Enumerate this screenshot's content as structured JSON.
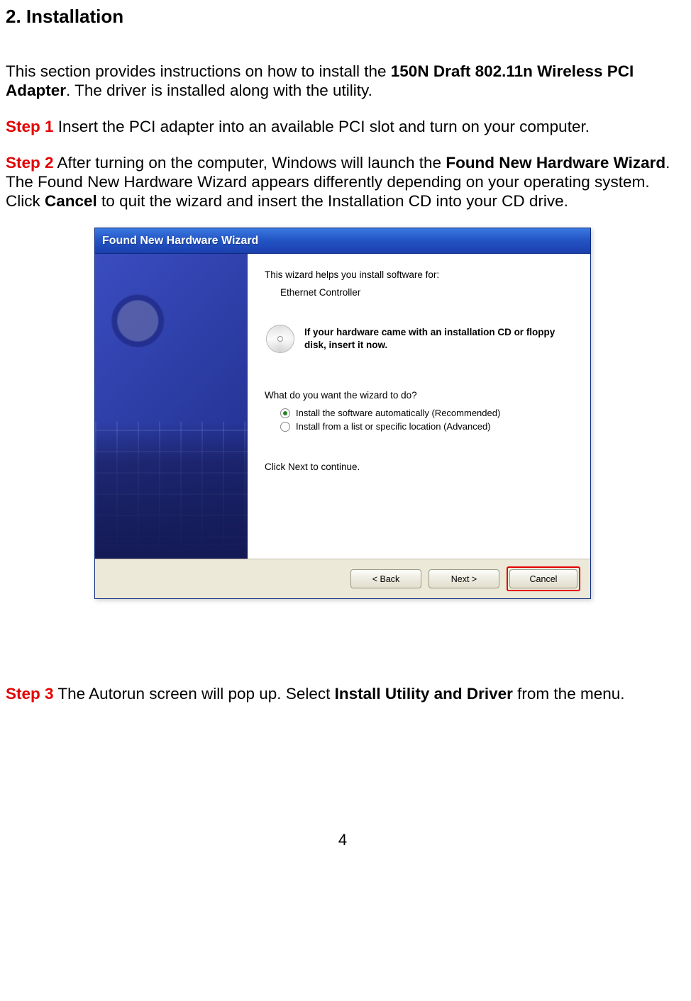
{
  "heading": "2. Installation",
  "intro_pre": "This section provides instructions on how to install the ",
  "intro_bold": "150N Draft 802.11n Wireless PCI Adapter",
  "intro_post": ". The driver is installed along with the utility.",
  "step1": {
    "label": "Step 1",
    "text": " Insert the PCI adapter into an available PCI slot and turn on your computer."
  },
  "step2": {
    "label": "Step 2",
    "seg_a": " After turning on the computer, Windows will launch the ",
    "bold_a": "Found New Hardware Wizard",
    "seg_b": ". The Found New Hardware Wizard appears differently depending on your operating system. Click ",
    "bold_b": "Cancel",
    "seg_c": " to quit the wizard and insert the Installation CD into your CD drive."
  },
  "wizard": {
    "title": "Found New Hardware Wizard",
    "line1": "This wizard helps you install software for:",
    "device": "Ethernet Controller",
    "cd_hint": "If your hardware came with an installation CD or floppy disk, insert it now.",
    "question": "What do you want the wizard to do?",
    "option1": "Install the software automatically (Recommended)",
    "option2": "Install from a list or specific location (Advanced)",
    "continue": "Click Next to continue.",
    "back": "< Back",
    "next": "Next >",
    "cancel": "Cancel"
  },
  "step3": {
    "label": "Step 3",
    "seg_a": " The Autorun screen will pop up. Select ",
    "bold_a": "Install Utility and Driver",
    "seg_b": " from the menu."
  },
  "page_number": "4"
}
